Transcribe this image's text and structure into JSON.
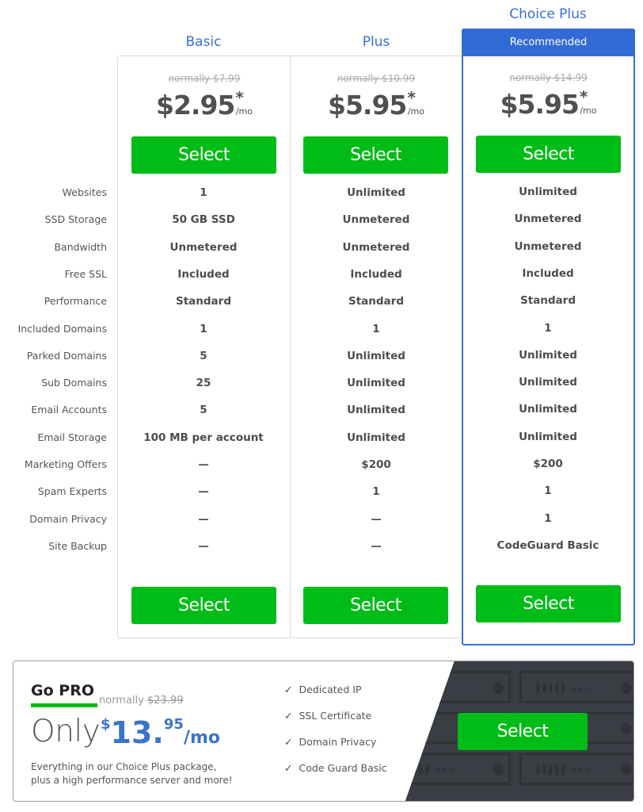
{
  "plans": [
    {
      "name": "Basic",
      "normally": "normally $7.99",
      "price": "$2.95",
      "asterisk": "*",
      "per": "/mo",
      "select_label": "Select",
      "values": [
        "1",
        "50 GB SSD",
        "Unmetered",
        "Included",
        "Standard",
        "1",
        "5",
        "25",
        "5",
        "100 MB per account",
        "—",
        "—",
        "—",
        "—"
      ]
    },
    {
      "name": "Plus",
      "normally": "normally $10.99",
      "price": "$5.95",
      "asterisk": "*",
      "per": "/mo",
      "select_label": "Select",
      "values": [
        "Unlimited",
        "Unmetered",
        "Unmetered",
        "Included",
        "Standard",
        "1",
        "Unlimited",
        "Unlimited",
        "Unlimited",
        "Unlimited",
        "$200",
        "1",
        "—",
        "—"
      ]
    },
    {
      "name": "Choice Plus",
      "badge": "Recommended",
      "normally": "normally $14.99",
      "price": "$5.95",
      "asterisk": "*",
      "per": "/mo",
      "select_label": "Select",
      "values": [
        "Unlimited",
        "Unmetered",
        "Unmetered",
        "Included",
        "Standard",
        "1",
        "Unlimited",
        "Unlimited",
        "Unlimited",
        "Unlimited",
        "$200",
        "1",
        "1",
        "CodeGuard Basic"
      ]
    }
  ],
  "features": [
    "Websites",
    "SSD Storage",
    "Bandwidth",
    "Free SSL",
    "Performance",
    "Included Domains",
    "Parked Domains",
    "Sub Domains",
    "Email Accounts",
    "Email Storage",
    "Marketing Offers",
    "Spam Experts",
    "Domain Privacy",
    "Site Backup"
  ],
  "go_pro": {
    "title": "Go PRO",
    "normally_prefix": "normally",
    "normally_price": "$23.99",
    "only": "Only",
    "currency": "$",
    "price_whole": "13.",
    "price_cents": "95",
    "per": "/mo",
    "description_line1": "Everything in our Choice Plus package,",
    "description_line2": "plus a high performance server and more!",
    "features": [
      "Dedicated IP",
      "SSL Certificate",
      "Domain Privacy",
      "Code Guard Basic"
    ],
    "check_glyph": "✓",
    "select_label": "Select"
  },
  "colors": {
    "accent_blue": "#336bd6",
    "select_green": "#00bc16",
    "pro_dark": "#3a3e44"
  }
}
